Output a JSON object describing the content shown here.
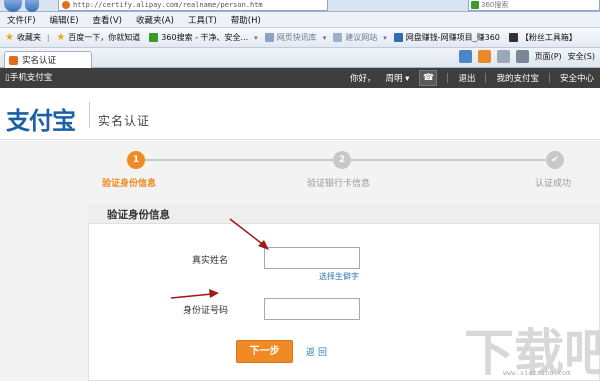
{
  "browser": {
    "url": "http://certify.alipay.com/realname/person.htm",
    "search_text": "360搜索",
    "menu": [
      "文件(F)",
      "编辑(E)",
      "查看(V)",
      "收藏夹(A)",
      "工具(T)",
      "帮助(H)"
    ],
    "favorites": [
      {
        "label": "收藏夹"
      },
      {
        "label": "百度一下，你就知道"
      },
      {
        "label": "360搜索 - 干净、安全..."
      },
      {
        "label": "网页快讯库"
      },
      {
        "label": "建议网站"
      },
      {
        "label": "网盘赚钱-网赚项目_赚360"
      },
      {
        "label": "【粉丝工具箱】"
      }
    ],
    "tab_title": "实名认证",
    "tools": {
      "page_label": "页面(P)",
      "safety_label": "安全(S)"
    }
  },
  "site_bar": {
    "mobile_link": "手机支付宝",
    "greeting": "你好，",
    "user": "周明",
    "logout": "退出",
    "my_alipay": "我的支付宝",
    "security_center": "安全中心"
  },
  "header": {
    "logo_text": "支付宝",
    "page_title": "实名认证"
  },
  "stepper": {
    "steps": [
      {
        "number": "1",
        "label": "验证身份信息",
        "state": "active"
      },
      {
        "number": "2",
        "label": "验证银行卡信息",
        "state": "pending"
      },
      {
        "number": "✔",
        "label": "认证成功",
        "state": "pending"
      }
    ],
    "active_color": "#f08a24",
    "pending_color": "#c8c8c8"
  },
  "form": {
    "section_title": "验证身份信息",
    "name_label": "真实姓名",
    "name_value": "",
    "rare_char_link": "选择生僻字",
    "id_label": "身份证号码",
    "id_value": "",
    "next_button": "下一步",
    "back_link": "返回"
  },
  "watermark": {
    "text": "下载吧",
    "url": "www.xiazaiba.com"
  }
}
